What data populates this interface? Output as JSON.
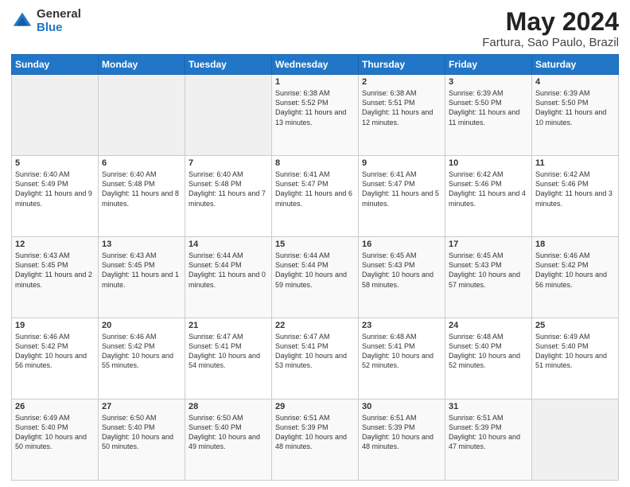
{
  "header": {
    "logo": {
      "general": "General",
      "blue": "Blue"
    },
    "title": "May 2024",
    "location": "Fartura, Sao Paulo, Brazil"
  },
  "calendar": {
    "days_of_week": [
      "Sunday",
      "Monday",
      "Tuesday",
      "Wednesday",
      "Thursday",
      "Friday",
      "Saturday"
    ],
    "weeks": [
      [
        {
          "day": "",
          "empty": true
        },
        {
          "day": "",
          "empty": true
        },
        {
          "day": "",
          "empty": true
        },
        {
          "day": "1",
          "sunrise": "6:38 AM",
          "sunset": "5:52 PM",
          "daylight": "11 hours and 13 minutes."
        },
        {
          "day": "2",
          "sunrise": "6:38 AM",
          "sunset": "5:51 PM",
          "daylight": "11 hours and 12 minutes."
        },
        {
          "day": "3",
          "sunrise": "6:39 AM",
          "sunset": "5:50 PM",
          "daylight": "11 hours and 11 minutes."
        },
        {
          "day": "4",
          "sunrise": "6:39 AM",
          "sunset": "5:50 PM",
          "daylight": "11 hours and 10 minutes."
        }
      ],
      [
        {
          "day": "5",
          "sunrise": "6:40 AM",
          "sunset": "5:49 PM",
          "daylight": "11 hours and 9 minutes."
        },
        {
          "day": "6",
          "sunrise": "6:40 AM",
          "sunset": "5:48 PM",
          "daylight": "11 hours and 8 minutes."
        },
        {
          "day": "7",
          "sunrise": "6:40 AM",
          "sunset": "5:48 PM",
          "daylight": "11 hours and 7 minutes."
        },
        {
          "day": "8",
          "sunrise": "6:41 AM",
          "sunset": "5:47 PM",
          "daylight": "11 hours and 6 minutes."
        },
        {
          "day": "9",
          "sunrise": "6:41 AM",
          "sunset": "5:47 PM",
          "daylight": "11 hours and 5 minutes."
        },
        {
          "day": "10",
          "sunrise": "6:42 AM",
          "sunset": "5:46 PM",
          "daylight": "11 hours and 4 minutes."
        },
        {
          "day": "11",
          "sunrise": "6:42 AM",
          "sunset": "5:46 PM",
          "daylight": "11 hours and 3 minutes."
        }
      ],
      [
        {
          "day": "12",
          "sunrise": "6:43 AM",
          "sunset": "5:45 PM",
          "daylight": "11 hours and 2 minutes."
        },
        {
          "day": "13",
          "sunrise": "6:43 AM",
          "sunset": "5:45 PM",
          "daylight": "11 hours and 1 minute."
        },
        {
          "day": "14",
          "sunrise": "6:44 AM",
          "sunset": "5:44 PM",
          "daylight": "11 hours and 0 minutes."
        },
        {
          "day": "15",
          "sunrise": "6:44 AM",
          "sunset": "5:44 PM",
          "daylight": "10 hours and 59 minutes."
        },
        {
          "day": "16",
          "sunrise": "6:45 AM",
          "sunset": "5:43 PM",
          "daylight": "10 hours and 58 minutes."
        },
        {
          "day": "17",
          "sunrise": "6:45 AM",
          "sunset": "5:43 PM",
          "daylight": "10 hours and 57 minutes."
        },
        {
          "day": "18",
          "sunrise": "6:46 AM",
          "sunset": "5:42 PM",
          "daylight": "10 hours and 56 minutes."
        }
      ],
      [
        {
          "day": "19",
          "sunrise": "6:46 AM",
          "sunset": "5:42 PM",
          "daylight": "10 hours and 56 minutes."
        },
        {
          "day": "20",
          "sunrise": "6:46 AM",
          "sunset": "5:42 PM",
          "daylight": "10 hours and 55 minutes."
        },
        {
          "day": "21",
          "sunrise": "6:47 AM",
          "sunset": "5:41 PM",
          "daylight": "10 hours and 54 minutes."
        },
        {
          "day": "22",
          "sunrise": "6:47 AM",
          "sunset": "5:41 PM",
          "daylight": "10 hours and 53 minutes."
        },
        {
          "day": "23",
          "sunrise": "6:48 AM",
          "sunset": "5:41 PM",
          "daylight": "10 hours and 52 minutes."
        },
        {
          "day": "24",
          "sunrise": "6:48 AM",
          "sunset": "5:40 PM",
          "daylight": "10 hours and 52 minutes."
        },
        {
          "day": "25",
          "sunrise": "6:49 AM",
          "sunset": "5:40 PM",
          "daylight": "10 hours and 51 minutes."
        }
      ],
      [
        {
          "day": "26",
          "sunrise": "6:49 AM",
          "sunset": "5:40 PM",
          "daylight": "10 hours and 50 minutes."
        },
        {
          "day": "27",
          "sunrise": "6:50 AM",
          "sunset": "5:40 PM",
          "daylight": "10 hours and 50 minutes."
        },
        {
          "day": "28",
          "sunrise": "6:50 AM",
          "sunset": "5:40 PM",
          "daylight": "10 hours and 49 minutes."
        },
        {
          "day": "29",
          "sunrise": "6:51 AM",
          "sunset": "5:39 PM",
          "daylight": "10 hours and 48 minutes."
        },
        {
          "day": "30",
          "sunrise": "6:51 AM",
          "sunset": "5:39 PM",
          "daylight": "10 hours and 48 minutes."
        },
        {
          "day": "31",
          "sunrise": "6:51 AM",
          "sunset": "5:39 PM",
          "daylight": "10 hours and 47 minutes."
        },
        {
          "day": "",
          "empty": true
        }
      ]
    ]
  }
}
